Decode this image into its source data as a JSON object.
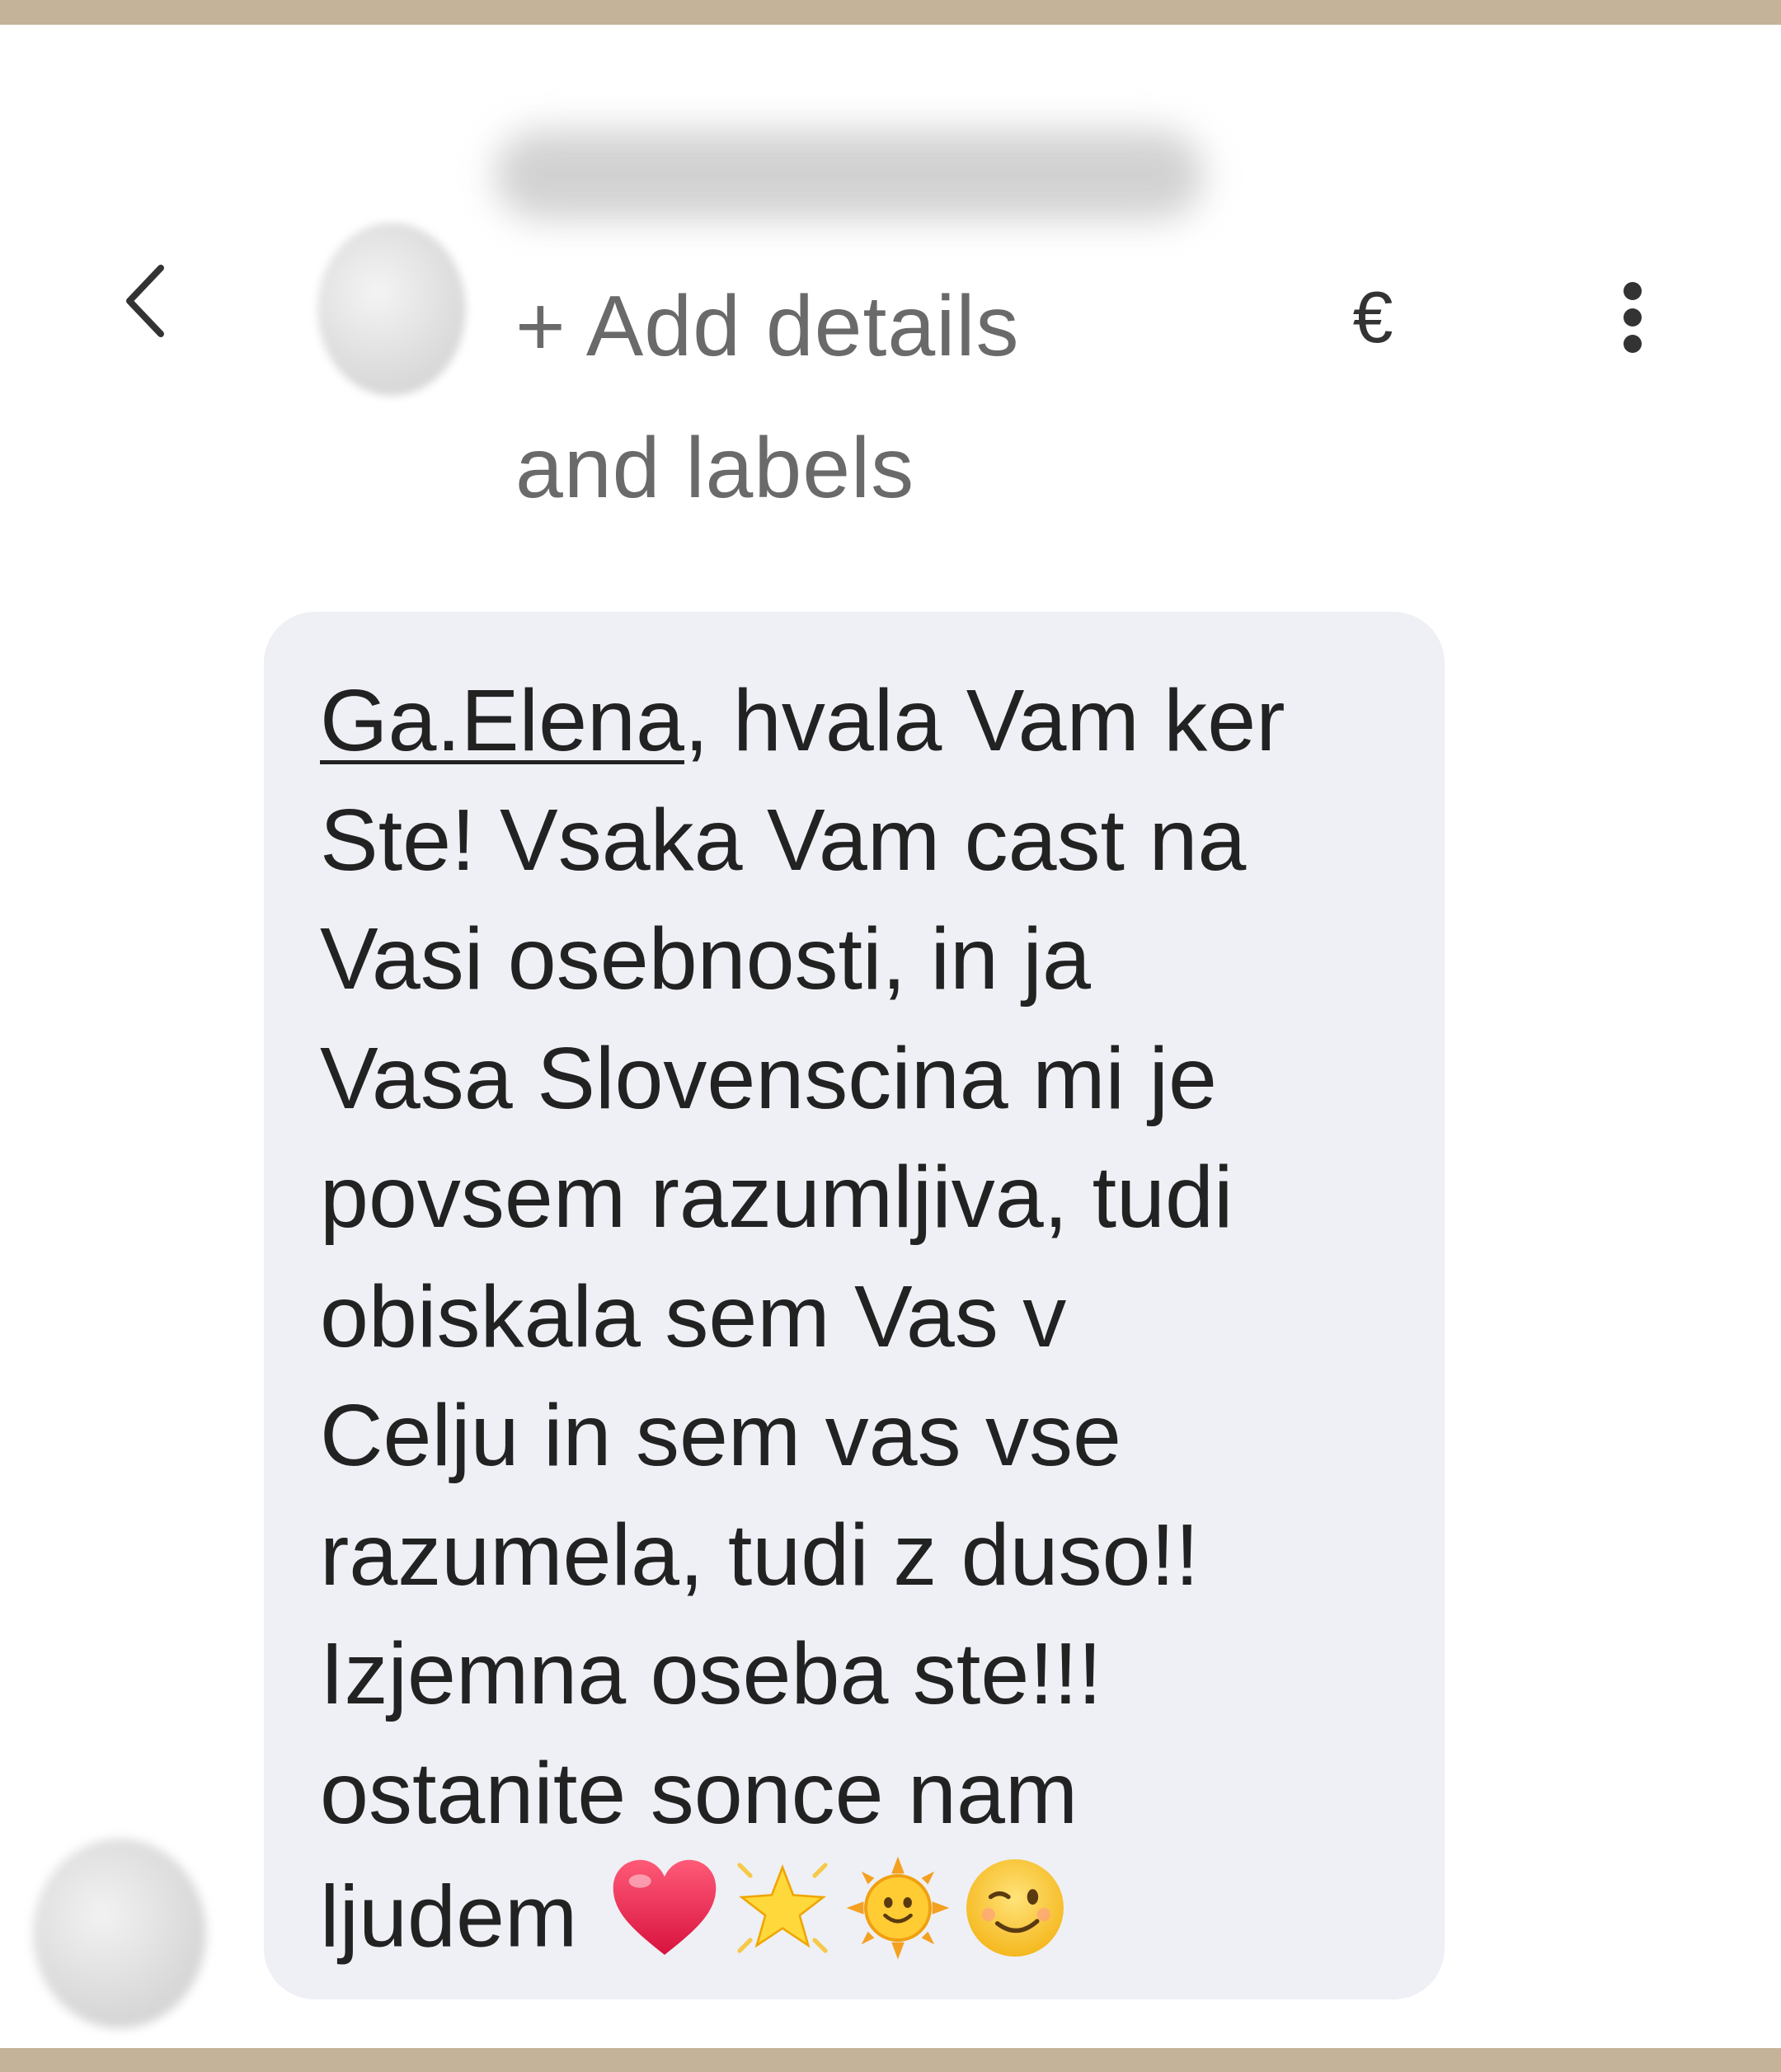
{
  "header": {
    "add_details_line1": "+ Add details",
    "add_details_line2": "and labels",
    "currency_symbol": "€"
  },
  "message": {
    "mention": "Ga.Elena",
    "first_line_rest": ", hvala Vam ker",
    "lines": [
      "Ste! Vsaka Vam cast na",
      "Vasi osebnosti, in ja",
      "Vasa Slovenscina mi je",
      "povsem razumljiva, tudi",
      "obiskala sem Vas  v",
      "Celju in sem vas vse",
      "razumela, tudi z duso!!",
      "Izjemna oseba ste!!!",
      "ostanite sonce nam"
    ],
    "last_line_text": "ljudem",
    "last_line_emojis": [
      "heart-emoji",
      "star-emoji",
      "sun-emoji",
      "winking-face-emoji"
    ]
  },
  "colors": {
    "frame": "#c4b398",
    "bubble": "#eef0f5",
    "text": "#222222",
    "header_text": "#6a6a6a"
  }
}
